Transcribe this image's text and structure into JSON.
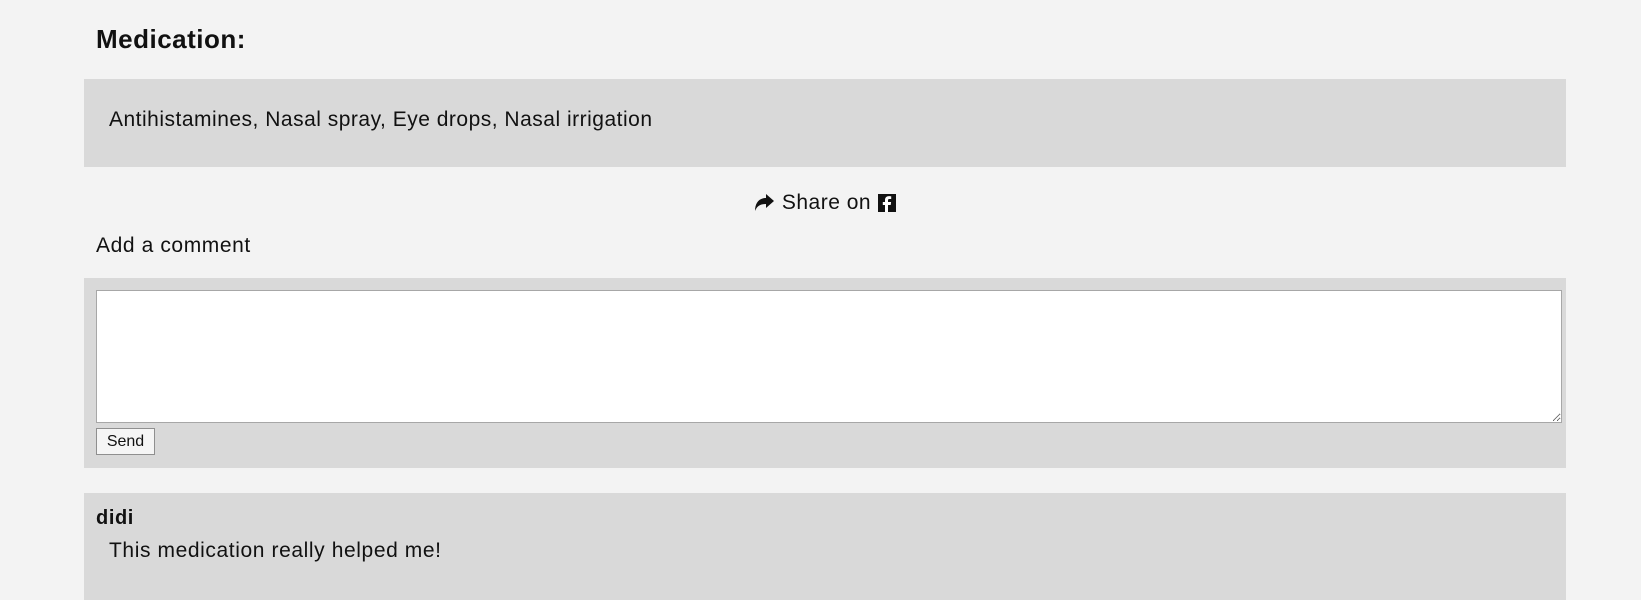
{
  "medication": {
    "heading": "Medication:",
    "list": "Antihistamines, Nasal spray, Eye drops, Nasal irrigation"
  },
  "share": {
    "label": "Share on",
    "arrow_icon": "share-arrow-icon",
    "facebook_icon": "facebook-icon"
  },
  "comment_form": {
    "label": "Add a comment",
    "textarea_value": "",
    "send_label": "Send"
  },
  "reviews": [
    {
      "author": "didi",
      "text": "This medication really helped me!"
    }
  ],
  "colors": {
    "page_background": "#f3f3f3",
    "panel_background": "#d9d9d9",
    "text": "#111111"
  }
}
